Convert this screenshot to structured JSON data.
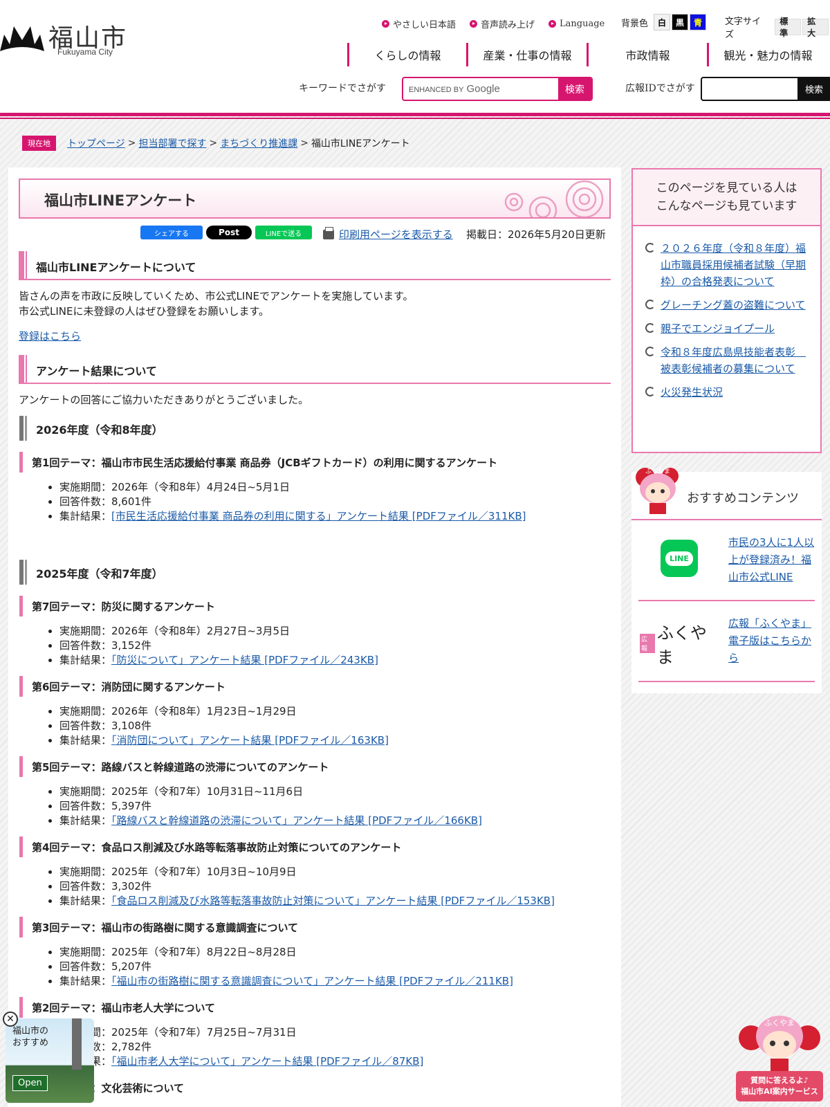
{
  "header": {
    "logo_jp": "福山市",
    "logo_en": "Fukuyama City",
    "util_links": [
      "やさしい日本語",
      "音声読み上げ",
      "Language"
    ],
    "bg_label": "背景色",
    "bg_options": [
      "白",
      "黒",
      "青"
    ],
    "font_label": "文字サイズ",
    "font_options": [
      "標準",
      "拡大"
    ],
    "nav": [
      "くらしの情報",
      "産業・仕事の情報",
      "市政情報",
      "観光・魅力の情報"
    ],
    "keyword_label": "キーワードでさがす",
    "google_enhanced": "ENHANCED BY",
    "google_brand": "Google",
    "search_button": "検索",
    "id_label": "広報IDでさがす",
    "id_button": "検索",
    "brand_color": "#d6156f"
  },
  "breadcrumb": {
    "here": "現在地",
    "items": [
      "トップページ",
      "担当部署で探す",
      "まちづくり推進課"
    ],
    "current": "福山市LINEアンケート"
  },
  "main": {
    "title": "福山市LINEアンケート",
    "share": {
      "facebook": "シェアする",
      "x": "Post",
      "line": "LINEで送る"
    },
    "print_link": "印刷用ページを表示する",
    "updated": "掲載日：2026年5月20日更新",
    "sec1_title": "福山市LINEアンケートについて",
    "sec1_text1": "皆さんの声を市政に反映していくため、市公式LINEでアンケートを実施しています。",
    "sec1_text2": "市公式LINEに未登録の人はぜひ登録をお願いします。",
    "register_link": "登録はこちら",
    "sec2_title": "アンケート結果について",
    "sec2_text": "アンケートの回答にご協力いただきありがとうございました。",
    "year_2026": "2026年度（令和8年度）",
    "year_2025": "2025年度（令和7年度）",
    "surveys": [
      {
        "theme": "第1回テーマ：福山市市民生活応援給付事業 商品券（JCBギフトカード）の利用に関するアンケート",
        "period": "実施期間：2026年（令和8年）4月24日~5月1日",
        "count": "回答件数：8,601件",
        "result_label": "集計結果：",
        "result_link": "[市民生活応援給付事業 商品券の利用に関する」アンケート結果 [PDFファイル／311KB]"
      },
      {
        "theme": "第7回テーマ：防災に関するアンケート",
        "period": "実施期間：2026年（令和8年）2月27日~3月5日",
        "count": "回答件数：3,152件",
        "result_label": "集計結果：",
        "result_link": "「防災について」アンケート結果 [PDFファイル／243KB]"
      },
      {
        "theme": "第6回テーマ：消防団に関するアンケート",
        "period": "実施期間：2026年（令和8年）1月23日~1月29日",
        "count": "回答件数：3,108件",
        "result_label": "集計結果：",
        "result_link": "「消防団について」アンケート結果 [PDFファイル／163KB]"
      },
      {
        "theme": "第5回テーマ：路線バスと幹線道路の渋滞についてのアンケート",
        "period": "実施期間：2025年（令和7年）10月31日~11月6日",
        "count": "回答件数：5,397件",
        "result_label": "集計結果：",
        "result_link": "「路線バスと幹線道路の渋滞について」アンケート結果 [PDFファイル／166KB]"
      },
      {
        "theme": "第4回テーマ：食品ロス削減及び水路等転落事故防止対策についてのアンケート",
        "period": "実施期間：2025年（令和7年）10月3日~10月9日",
        "count": "回答件数：3,302件",
        "result_label": "集計結果：",
        "result_link": "「食品ロス削減及び水路等転落事故防止対策について」アンケート結果 [PDFファイル／153KB]"
      },
      {
        "theme": "第3回テーマ：福山市の街路樹に関する意識調査について",
        "period": "実施期間：2025年（令和7年）8月22日~8月28日",
        "count": "回答件数：5,207件",
        "result_label": "集計結果：",
        "result_link": "「福山市の街路樹に関する意識調査について」アンケート結果 [PDFファイル／211KB]"
      },
      {
        "theme": "第2回テーマ：福山市老人大学について",
        "period": "実施期間：2025年（令和7年）7月25日~7月31日",
        "count": "回答件数：2,782件",
        "result_label": "集計結果：",
        "result_link": "「福山市老人大学について」アンケート結果 [PDFファイル／87KB]"
      },
      {
        "theme": "第1回テーマ：文化芸術について"
      }
    ]
  },
  "sidebar": {
    "related_title_1": "このページを見ている人は",
    "related_title_2": "こんなページも見ています",
    "related": [
      "２０２６年度（令和８年度）福山市職員採用候補者試験（早期枠）の合格発表について",
      "グレーチング蓋の盗難について",
      "親子でエンジョイプール",
      "令和８年度広島県技能者表彰　被表彰候補者の募集について",
      "火災発生状況"
    ],
    "reco_title": "おすすめコンテンツ",
    "reco_line_logo": "LINE",
    "reco_line_text": "市民の3人に1人以上が登録済み！福山市公式LINE",
    "reco_koho_badge": "広報",
    "reco_koho_logo": "ふくやま",
    "reco_koho_text": "広報「ふくやま」電子版はこちらから",
    "mascot_label": "ふくやま"
  },
  "floaters": {
    "left_title_1": "福山市の",
    "left_title_2": "おすすめ",
    "left_open": "Open",
    "right_label": "ふくやま",
    "right_caption_1": "質問に答えるよ♪",
    "right_caption_2": "福山市AI案内サービス"
  }
}
